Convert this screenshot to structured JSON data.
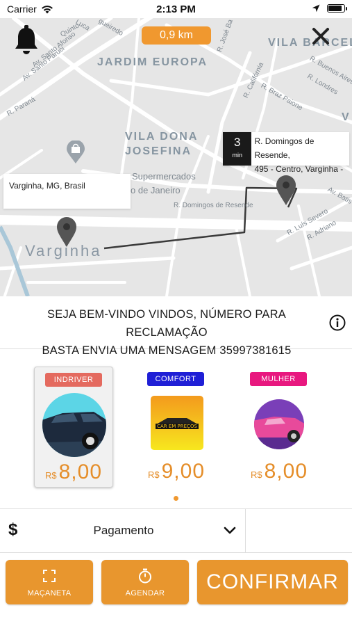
{
  "status_bar": {
    "carrier": "Carrier",
    "time": "2:13 PM"
  },
  "map": {
    "distance": "0,9 km",
    "neighborhoods": [
      "JARDIM EUROPA",
      "VILA DONA",
      "JOSEFINA",
      "VILA BARCEL",
      "V"
    ],
    "city_label": "Varginha",
    "streets": {
      "paruci": "Av. Santo Paruci",
      "afonso": "Av. Santo Afonso",
      "luca": "Luca",
      "quinto": "Quinto",
      "gueiredo": "gueiredo",
      "parana": "R. Paraná",
      "jose": "R. José Ba",
      "california": "R. Califórnia",
      "buenos_aires": "R. Buenos Aires",
      "londres": "R. Londres",
      "braz_paione": "R. Braz Paione",
      "domingos": "R. Domingos de Resende",
      "luis_severo": "R. Luís Severo",
      "adriano": "R. Adriano",
      "batista": "Av. Batis",
      "supermercados": "Supermercados",
      "rio": "o de Janeiro"
    },
    "origin_callout": "Varginha, MG, Brasil",
    "eta": {
      "value": "3",
      "unit": "min"
    },
    "destination_callout": {
      "line1": "R. Domingos de Resende,",
      "line2": "495 - Centro, Varginha -"
    }
  },
  "welcome": {
    "line1": "SEJA BEM-VINDO VINDOS, NÚMERO PARA RECLAMAÇÃO",
    "line2": "BASTA ENVIA UMA MENSAGEM 35997381615"
  },
  "ride_options": [
    {
      "name": "INDRIVER",
      "currency": "R$",
      "price": "8,00",
      "badge_color": "#e46a5f",
      "selected": true
    },
    {
      "name": "COMFORT",
      "currency": "R$",
      "price": "9,00",
      "badge_color": "#1f1fd6",
      "selected": false,
      "logo_text": "CAR EM PREÇOS"
    },
    {
      "name": "MULHER",
      "currency": "R$",
      "price": "8,00",
      "badge_color": "#e8187f",
      "selected": false
    }
  ],
  "payment": {
    "icon": "$",
    "label": "Pagamento"
  },
  "buttons": {
    "handle": "MAÇANETA",
    "schedule": "AGENDAR",
    "confirm": "CONFIRMAR"
  },
  "colors": {
    "accent": "#e8962e",
    "map_bg": "#e6e6e6",
    "route": "#3a3a3a"
  }
}
